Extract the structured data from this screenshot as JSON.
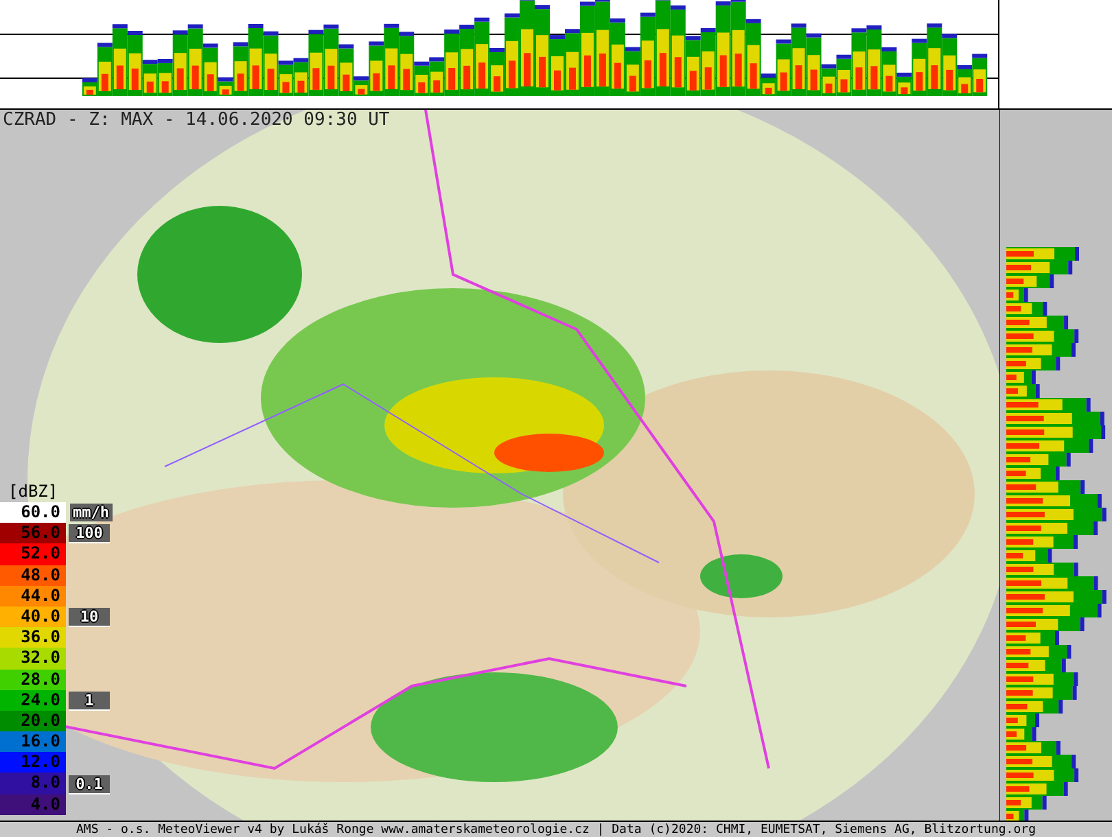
{
  "map": {
    "title": "CZRAD - Z: MAX - 14.06.2020 09:30 UT"
  },
  "legend": {
    "unit": "[dBZ]",
    "rate_unit": "mm/h",
    "entries": [
      {
        "value": "60.0",
        "color": "#ffffff"
      },
      {
        "value": "56.0",
        "color": "#a00000",
        "rate": "100"
      },
      {
        "value": "52.0",
        "color": "#ff0000"
      },
      {
        "value": "48.0",
        "color": "#ff5a00"
      },
      {
        "value": "44.0",
        "color": "#ff8800"
      },
      {
        "value": "40.0",
        "color": "#ffb000",
        "rate": "10"
      },
      {
        "value": "36.0",
        "color": "#e0d800"
      },
      {
        "value": "32.0",
        "color": "#a8dc00"
      },
      {
        "value": "28.0",
        "color": "#40d000"
      },
      {
        "value": "24.0",
        "color": "#00b400",
        "rate": "1"
      },
      {
        "value": "20.0",
        "color": "#008c00"
      },
      {
        "value": "16.0",
        "color": "#0070d0"
      },
      {
        "value": "12.0",
        "color": "#0010ff"
      },
      {
        "value": "8.0",
        "color": "#3010a0",
        "rate": "0.1"
      },
      {
        "value": "4.0",
        "color": "#40107a"
      }
    ]
  },
  "footer": "AMS - o.s. MeteoViewer v4 by Lukáš Ronge www.amaterskameteorologie.cz | Data (c)2020: CHMI, EUMETSAT, Siemens AG, Blitzortung.org"
}
